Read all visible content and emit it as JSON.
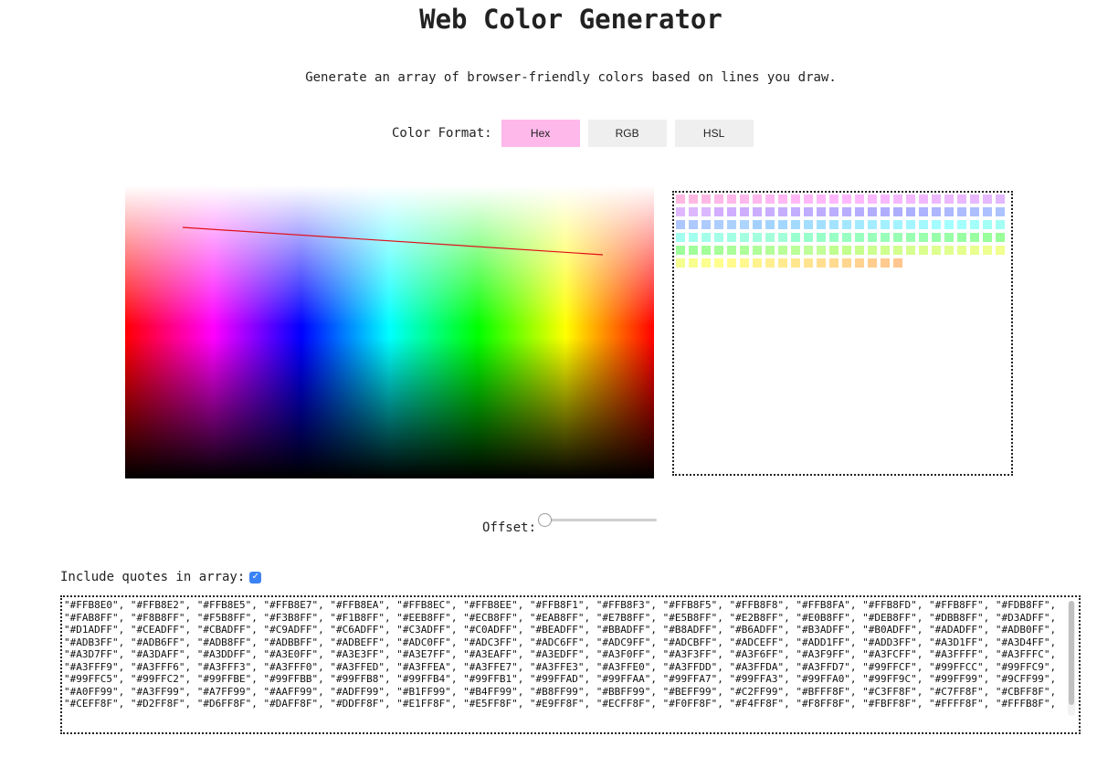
{
  "header": {
    "title": "Web Color Generator",
    "subtitle": "Generate an array of browser-friendly colors based on lines you draw."
  },
  "format": {
    "label": "Color Format:",
    "options": [
      "Hex",
      "RGB",
      "HSL"
    ],
    "selected": "Hex",
    "active_color": "#FFB8EA",
    "inactive_color": "#EFEFEF"
  },
  "canvas": {
    "line_color": "#E0101A"
  },
  "swatches": {
    "colors": [
      "#FFB8E0",
      "#FFB8E2",
      "#FFB8E5",
      "#FFB8E7",
      "#FFB8EA",
      "#FFB8EC",
      "#FFB8EE",
      "#FFB8F1",
      "#FFB8F3",
      "#FFB8F5",
      "#FFB8F8",
      "#FFB8FA",
      "#FFB8FD",
      "#FFB8FF",
      "#FDB8FF",
      "#FAB8FF",
      "#F8B8FF",
      "#F5B8FF",
      "#F3B8FF",
      "#F1B8FF",
      "#EEB8FF",
      "#ECB8FF",
      "#EAB8FF",
      "#E7B8FF",
      "#E5B8FF",
      "#E2B8FF",
      "#E0B8FF",
      "#DEB8FF",
      "#DBB8FF",
      "#D3ADFF",
      "#D1ADFF",
      "#CEADFF",
      "#CBADFF",
      "#C9ADFF",
      "#C6ADFF",
      "#C3ADFF",
      "#C0ADFF",
      "#BEADFF",
      "#BBADFF",
      "#B8ADFF",
      "#B6ADFF",
      "#B3ADFF",
      "#B0ADFF",
      "#ADADFF",
      "#ADB0FF",
      "#ADB3FF",
      "#ADB6FF",
      "#ADB8FF",
      "#ADBBFF",
      "#ADBEFF",
      "#ADC0FF",
      "#ADC3FF",
      "#ADC6FF",
      "#ADC9FF",
      "#ADCBFF",
      "#ADCEFF",
      "#ADD1FF",
      "#ADD3FF",
      "#A3D1FF",
      "#A3D4FF",
      "#A3D7FF",
      "#A3DAFF",
      "#A3DDFF",
      "#A3E0FF",
      "#A3E3FF",
      "#A3E7FF",
      "#A3EAFF",
      "#A3EDFF",
      "#A3F0FF",
      "#A3F3FF",
      "#A3F6FF",
      "#A3F9FF",
      "#A3FCFF",
      "#A3FFFF",
      "#A3FFFC",
      "#A3FFF9",
      "#A3FFF6",
      "#A3FFF3",
      "#A3FFF0",
      "#A3FFED",
      "#A3FFEA",
      "#A3FFE7",
      "#A3FFE3",
      "#A3FFE0",
      "#A3FFDD",
      "#A3FFDA",
      "#A3FFD7",
      "#99FFCF",
      "#99FFCC",
      "#99FFC9",
      "#99FFC5",
      "#99FFC2",
      "#99FFBE",
      "#99FFBB",
      "#99FFB8",
      "#99FFB4",
      "#99FFB1",
      "#99FFAD",
      "#99FFAA",
      "#99FFA7",
      "#99FFA3",
      "#99FFA0",
      "#99FF9C",
      "#99FF99",
      "#9CFF99",
      "#A0FF99",
      "#A3FF99",
      "#A7FF99",
      "#AAFF99",
      "#ADFF99",
      "#B1FF99",
      "#B4FF99",
      "#B8FF99",
      "#BBFF99",
      "#BEFF99",
      "#C2FF99",
      "#BFFF8F",
      "#C3FF8F",
      "#C7FF8F",
      "#CBFF8F",
      "#CEFF8F",
      "#D2FF8F",
      "#D6FF8F",
      "#DAFF8F",
      "#DDFF8F",
      "#E1FF8F",
      "#E5FF8F",
      "#E9FF8F",
      "#ECFF8F",
      "#F0FF8F",
      "#F4FF8F",
      "#F8FF8F",
      "#FBFF8F",
      "#FFFF8F",
      "#FFFB8F",
      "#FFF78F",
      "#FFF38F",
      "#FFEF8F",
      "#FFEB8F",
      "#FFE78F",
      "#FFE38F",
      "#FFDF8F",
      "#FFDA8F",
      "#FFD68F",
      "#FFD28F",
      "#FFCE8F",
      "#FFCA8F",
      "#FFC68F"
    ]
  },
  "offset": {
    "label": "Offset:",
    "value": 0
  },
  "quotes": {
    "label": "Include quotes in array:",
    "checked": true
  },
  "output": {
    "text": "\"#FFB8E0\", \"#FFB8E2\", \"#FFB8E5\", \"#FFB8E7\", \"#FFB8EA\", \"#FFB8EC\", \"#FFB8EE\", \"#FFB8F1\", \"#FFB8F3\", \"#FFB8F5\", \"#FFB8F8\", \"#FFB8FA\", \"#FFB8FD\", \"#FFB8FF\", \"#FDB8FF\",\n\"#FAB8FF\", \"#F8B8FF\", \"#F5B8FF\", \"#F3B8FF\", \"#F1B8FF\", \"#EEB8FF\", \"#ECB8FF\", \"#EAB8FF\", \"#E7B8FF\", \"#E5B8FF\", \"#E2B8FF\", \"#E0B8FF\", \"#DEB8FF\", \"#DBB8FF\", \"#D3ADFF\",\n\"#D1ADFF\", \"#CEADFF\", \"#CBADFF\", \"#C9ADFF\", \"#C6ADFF\", \"#C3ADFF\", \"#C0ADFF\", \"#BEADFF\", \"#BBADFF\", \"#B8ADFF\", \"#B6ADFF\", \"#B3ADFF\", \"#B0ADFF\", \"#ADADFF\", \"#ADB0FF\",\n\"#ADB3FF\", \"#ADB6FF\", \"#ADB8FF\", \"#ADBBFF\", \"#ADBEFF\", \"#ADC0FF\", \"#ADC3FF\", \"#ADC6FF\", \"#ADC9FF\", \"#ADCBFF\", \"#ADCEFF\", \"#ADD1FF\", \"#ADD3FF\", \"#A3D1FF\", \"#A3D4FF\",\n\"#A3D7FF\", \"#A3DAFF\", \"#A3DDFF\", \"#A3E0FF\", \"#A3E3FF\", \"#A3E7FF\", \"#A3EAFF\", \"#A3EDFF\", \"#A3F0FF\", \"#A3F3FF\", \"#A3F6FF\", \"#A3F9FF\", \"#A3FCFF\", \"#A3FFFF\", \"#A3FFFC\",\n\"#A3FFF9\", \"#A3FFF6\", \"#A3FFF3\", \"#A3FFF0\", \"#A3FFED\", \"#A3FFEA\", \"#A3FFE7\", \"#A3FFE3\", \"#A3FFE0\", \"#A3FFDD\", \"#A3FFDA\", \"#A3FFD7\", \"#99FFCF\", \"#99FFCC\", \"#99FFC9\",\n\"#99FFC5\", \"#99FFC2\", \"#99FFBE\", \"#99FFBB\", \"#99FFB8\", \"#99FFB4\", \"#99FFB1\", \"#99FFAD\", \"#99FFAA\", \"#99FFA7\", \"#99FFA3\", \"#99FFA0\", \"#99FF9C\", \"#99FF99\", \"#9CFF99\",\n\"#A0FF99\", \"#A3FF99\", \"#A7FF99\", \"#AAFF99\", \"#ADFF99\", \"#B1FF99\", \"#B4FF99\", \"#B8FF99\", \"#BBFF99\", \"#BEFF99\", \"#C2FF99\", \"#BFFF8F\", \"#C3FF8F\", \"#C7FF8F\", \"#CBFF8F\",\n\"#CEFF8F\", \"#D2FF8F\", \"#D6FF8F\", \"#DAFF8F\", \"#DDFF8F\", \"#E1FF8F\", \"#E5FF8F\", \"#E9FF8F\", \"#ECFF8F\", \"#F0FF8F\", \"#F4FF8F\", \"#F8FF8F\", \"#FBFF8F\", \"#FFFF8F\", \"#FFFB8F\","
  }
}
